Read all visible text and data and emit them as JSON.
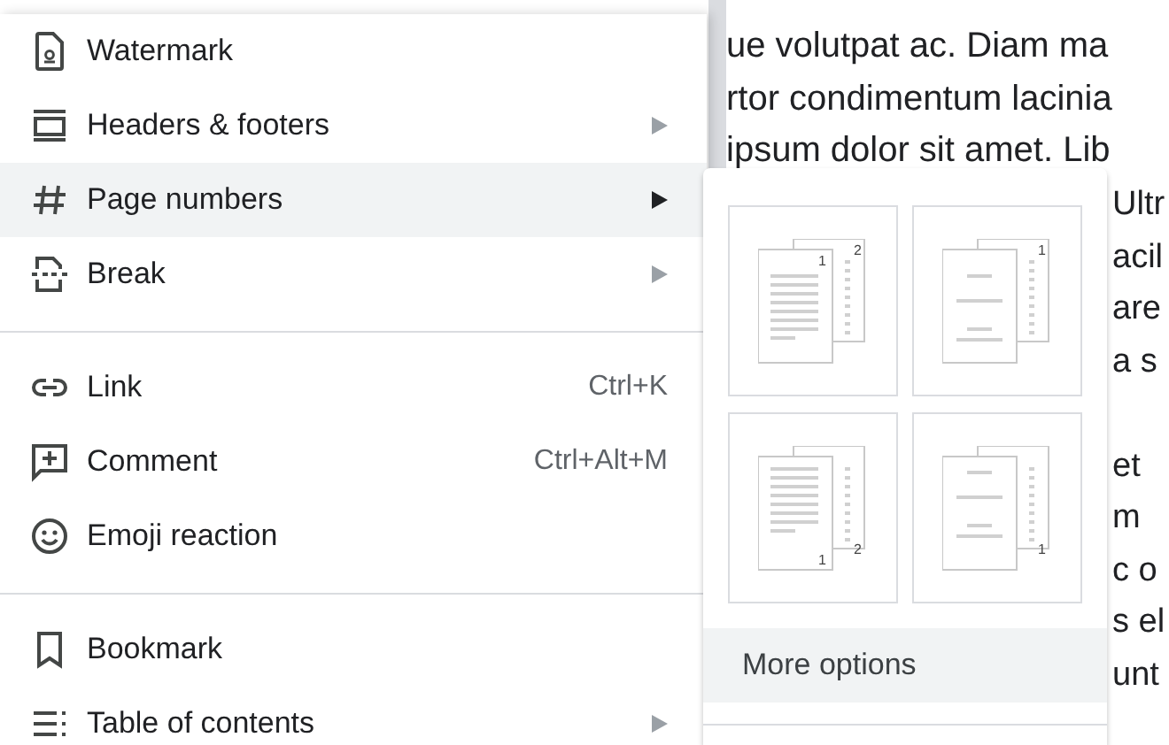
{
  "document": {
    "lines": [
      "ue volutpat ac. Diam ma",
      "rtor condimentum lacinia",
      "ipsum dolor sit amet. Lib"
    ],
    "side_paragraphs": [
      [
        "Ultr",
        "acil",
        "are",
        "a s"
      ],
      [
        "et",
        "m",
        "c o",
        "s el",
        "unt"
      ]
    ]
  },
  "menu": {
    "items": [
      {
        "kind": "item",
        "label": "Watermark",
        "submenu": false,
        "selected": false
      },
      {
        "kind": "item",
        "label": "Headers & footers",
        "submenu": true,
        "selected": false
      },
      {
        "kind": "item",
        "label": "Page numbers",
        "submenu": true,
        "selected": true
      },
      {
        "kind": "item",
        "label": "Break",
        "submenu": true,
        "selected": false
      },
      {
        "kind": "divider"
      },
      {
        "kind": "item",
        "label": "Link",
        "shortcut": "Ctrl+K",
        "submenu": false,
        "selected": false
      },
      {
        "kind": "item",
        "label": "Comment",
        "shortcut": "Ctrl+Alt+M",
        "submenu": false,
        "selected": false
      },
      {
        "kind": "item",
        "label": "Emoji reaction",
        "submenu": false,
        "selected": false
      },
      {
        "kind": "divider"
      },
      {
        "kind": "item",
        "label": "Bookmark",
        "submenu": false,
        "selected": false
      },
      {
        "kind": "item",
        "label": "Table of contents",
        "submenu": true,
        "selected": false
      }
    ]
  },
  "submenu": {
    "tiles": [
      {
        "kind": "header",
        "front_number": "1",
        "back_number": "2"
      },
      {
        "kind": "header",
        "back_number": "1"
      },
      {
        "kind": "footer",
        "front_number": "1",
        "back_number": "2"
      },
      {
        "kind": "footer",
        "back_number": "1"
      }
    ],
    "more": {
      "label": "More options",
      "selected": true
    }
  }
}
